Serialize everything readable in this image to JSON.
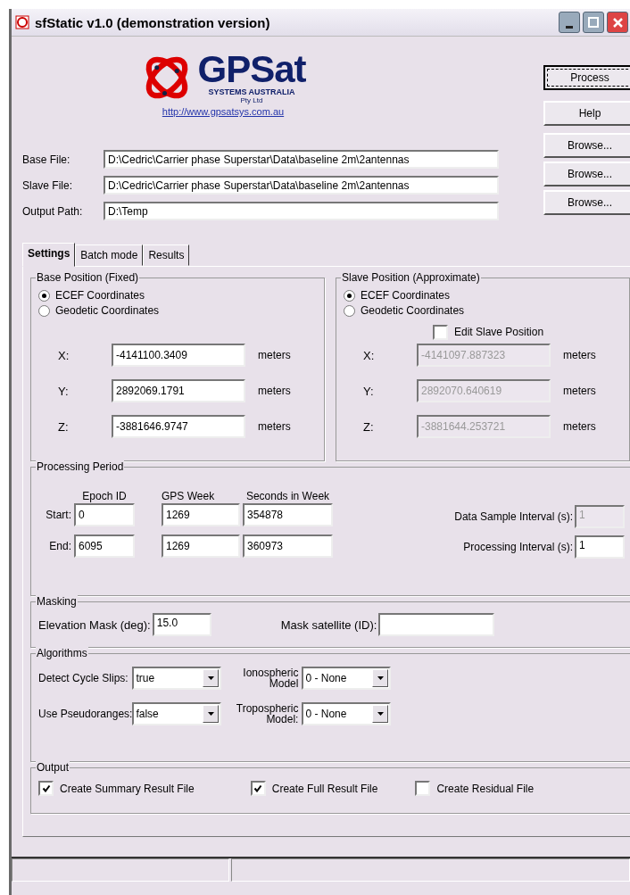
{
  "window": {
    "title": "sfStatic v1.0 (demonstration version)"
  },
  "logo": {
    "name": "GPSat",
    "subtitle": "SYSTEMS AUSTRALIA",
    "suffix": "Pty Ltd",
    "link": "http://www.gpsatsys.com.au"
  },
  "buttons": [
    {
      "label": "Process",
      "focused": true
    },
    {
      "label": "Help",
      "focused": false
    }
  ],
  "files": [
    {
      "label": "Base File:",
      "value": "D:\\Cedric\\Carrier phase Superstar\\Data\\baseline 2m\\2antennas",
      "button": "Browse..."
    },
    {
      "label": "Slave File:",
      "value": "D:\\Cedric\\Carrier phase Superstar\\Data\\baseline 2m\\2antennas",
      "button": "Browse..."
    },
    {
      "label": "Output Path:",
      "value": "D:\\Temp",
      "button": "Browse..."
    }
  ],
  "tabs": [
    {
      "label": "Settings",
      "selected": true
    },
    {
      "label": "Batch mode",
      "selected": false
    },
    {
      "label": "Results",
      "selected": false
    }
  ],
  "positions": [
    {
      "title": "Base Position (Fixed)",
      "options": [
        {
          "label": "ECEF Coordinates",
          "selected": true
        },
        {
          "label": "Geodetic Coordinates",
          "selected": false
        }
      ],
      "coords": [
        {
          "label": "X:",
          "value": "-4141100.3409",
          "unit": "meters",
          "disabled": false
        },
        {
          "label": "Y:",
          "value": "2892069.1791",
          "unit": "meters",
          "disabled": false
        },
        {
          "label": "Z:",
          "value": "-3881646.9747",
          "unit": "meters",
          "disabled": false
        }
      ]
    },
    {
      "title": "Slave Position (Approximate)",
      "options": [
        {
          "label": "ECEF Coordinates",
          "selected": true
        },
        {
          "label": "Geodetic Coordinates",
          "selected": false
        }
      ],
      "edit_checkbox": {
        "label": "Edit Slave Position",
        "checked": false
      },
      "coords": [
        {
          "label": "X:",
          "value": "-4141097.887323",
          "unit": "meters",
          "disabled": true
        },
        {
          "label": "Y:",
          "value": "2892070.640619",
          "unit": "meters",
          "disabled": true
        },
        {
          "label": "Z:",
          "value": "-3881644.253721",
          "unit": "meters",
          "disabled": true
        }
      ]
    }
  ],
  "processing_period": {
    "title": "Processing Period",
    "columns": [
      "Epoch ID",
      "GPS Week",
      "Seconds in Week"
    ],
    "rows": [
      {
        "label": "Start:",
        "values": [
          "0",
          "1269",
          "354878"
        ]
      },
      {
        "label": "End:",
        "values": [
          "6095",
          "1269",
          "360973"
        ]
      }
    ],
    "intervals": [
      {
        "label": "Data Sample Interval (s):",
        "value": "1",
        "disabled": true
      },
      {
        "label": "Processing Interval (s):",
        "value": "1",
        "disabled": false
      }
    ]
  },
  "masking": {
    "title": "Masking",
    "fields": [
      {
        "label": "Elevation Mask (deg):",
        "value": "15.0"
      },
      {
        "label": "Mask satellite (ID):"
      }
    ]
  },
  "algorithms": {
    "title": "Algorithms",
    "dropdowns": [
      {
        "label": "Detect Cycle Slips:",
        "value": "true"
      },
      {
        "label": "Ionospheric Model",
        "value": "0 - None"
      },
      {
        "label": "Use Pseudoranges:",
        "value": "false"
      },
      {
        "label": "Tropospheric Model:",
        "value": "0 - None"
      }
    ]
  },
  "output": {
    "title": "Output",
    "checkboxes": [
      {
        "label": "Create Summary Result File",
        "checked": true
      },
      {
        "label": "Create Full Result File",
        "checked": true
      },
      {
        "label": "Create Residual File",
        "checked": false
      }
    ]
  }
}
